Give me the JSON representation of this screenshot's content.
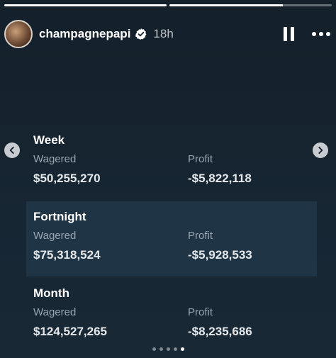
{
  "story": {
    "progress": [
      1.0,
      0.7
    ],
    "username": "champagnepapi",
    "time_ago": "18h",
    "icons": {
      "verified": "verified-badge-icon",
      "pause": "pause-icon",
      "more": "more-options-icon",
      "prev": "chevron-left-icon",
      "next": "chevron-right-icon"
    }
  },
  "stats": [
    {
      "period": "Week",
      "wagered_label": "Wagered",
      "wagered": "$50,255,270",
      "profit_label": "Profit",
      "profit": "-$5,822,118"
    },
    {
      "period": "Fortnight",
      "wagered_label": "Wagered",
      "wagered": "$75,318,524",
      "profit_label": "Profit",
      "profit": "-$5,928,533"
    },
    {
      "period": "Month",
      "wagered_label": "Wagered",
      "wagered": "$124,527,265",
      "profit_label": "Profit",
      "profit": "-$8,235,686"
    }
  ],
  "carousel": {
    "count": 5,
    "active_index": 4
  },
  "colors": {
    "background": "#15212b",
    "highlight_row": "#1f3444",
    "label": "#98a6b2",
    "value": "#e4e8eb"
  }
}
